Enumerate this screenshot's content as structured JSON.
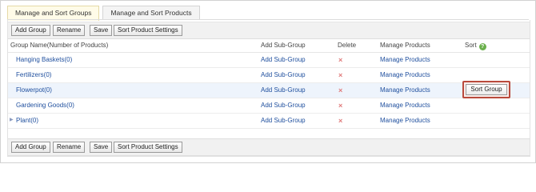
{
  "tabs": [
    {
      "label": "Manage and Sort Groups",
      "active": true
    },
    {
      "label": "Manage and Sort Products",
      "active": false
    }
  ],
  "toolbar": {
    "add_group": "Add Group",
    "rename": "Rename",
    "save": "Save",
    "sort_settings": "Sort Product Settings"
  },
  "columns": {
    "group_name": "Group Name(Number of Products)",
    "add_sub": "Add Sub-Group",
    "delete": "Delete",
    "manage": "Manage Products",
    "sort": "Sort"
  },
  "rows": [
    {
      "name": "Hanging Baskets(0)",
      "add_sub": "Add Sub-Group",
      "delete": "×",
      "manage": "Manage Products",
      "expandable": false
    },
    {
      "name": "Fertilizers(0)",
      "add_sub": "Add Sub-Group",
      "delete": "×",
      "manage": "Manage Products",
      "expandable": false
    },
    {
      "name": "Flowerpot(0)",
      "add_sub": "Add Sub-Group",
      "delete": "×",
      "manage": "Manage Products",
      "expandable": false,
      "sort_button": "Sort Group"
    },
    {
      "name": "Gardening Goods(0)",
      "add_sub": "Add Sub-Group",
      "delete": "×",
      "manage": "Manage Products",
      "expandable": false
    },
    {
      "name": "Plant(0)",
      "add_sub": "Add Sub-Group",
      "delete": "×",
      "manage": "Manage Products",
      "expandable": true
    }
  ],
  "icons": {
    "help": "question-mark-icon",
    "delete": "x-icon",
    "expand": "triangle-right-icon"
  },
  "colors": {
    "link": "#1f4f9e",
    "delete": "#e07a7a",
    "highlight_row": "#eef4fc",
    "sort_group_outline": "#b94a3c",
    "help_icon": "#6ab04c"
  }
}
